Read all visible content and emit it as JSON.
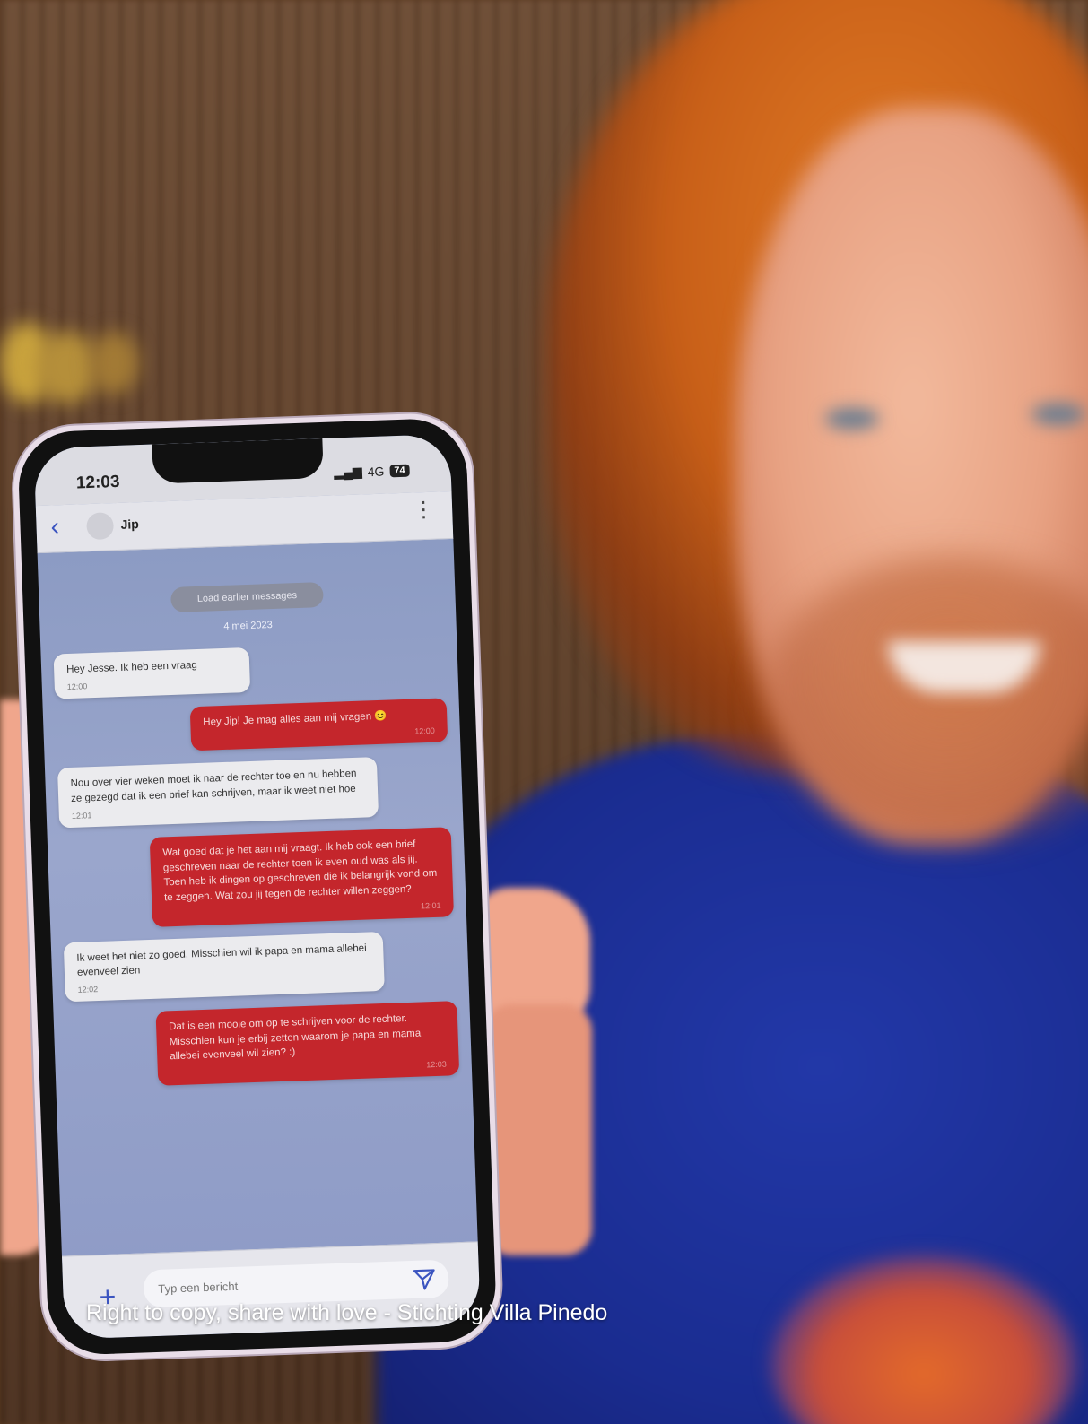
{
  "phone": {
    "status": {
      "time": "12:03",
      "network": "4G",
      "battery": "74"
    },
    "header": {
      "contact_name": "Jip"
    },
    "chat": {
      "load_older_label": "Load earlier messages",
      "date_separator": "4 mei 2023",
      "messages": [
        {
          "direction": "in",
          "text": "Hey Jesse. Ik heb een vraag",
          "time": "12:00"
        },
        {
          "direction": "out",
          "text": "Hey Jip! Je mag alles aan mij vragen 😊",
          "time": "12:00"
        },
        {
          "direction": "in",
          "text": "Nou over vier weken moet ik naar de rechter toe en nu hebben ze gezegd dat ik een brief kan schrijven, maar ik weet niet hoe",
          "time": "12:01"
        },
        {
          "direction": "out",
          "text": "Wat goed dat je het aan mij vraagt. Ik heb ook een brief geschreven naar de rechter toen ik even oud was als jij. Toen heb ik dingen op geschreven die ik belangrijk vond om te zeggen. Wat zou jij tegen de rechter willen zeggen?",
          "time": "12:01"
        },
        {
          "direction": "in",
          "text": "Ik weet het niet zo goed. Misschien wil ik papa en mama allebei evenveel zien",
          "time": "12:02"
        },
        {
          "direction": "out",
          "text": "Dat is een mooie om op te schrijven voor de rechter. Misschien kun je erbij zetten waarom je papa en mama allebei evenveel wil zien? :)",
          "time": "12:03"
        }
      ]
    },
    "composer": {
      "placeholder": "Typ een bericht"
    }
  },
  "caption": "Right to copy, share with love - Stichting Villa Pinedo",
  "colors": {
    "outgoing_bubble": "#c4262c",
    "incoming_bubble": "#ebebee",
    "accent": "#3b54c0"
  }
}
